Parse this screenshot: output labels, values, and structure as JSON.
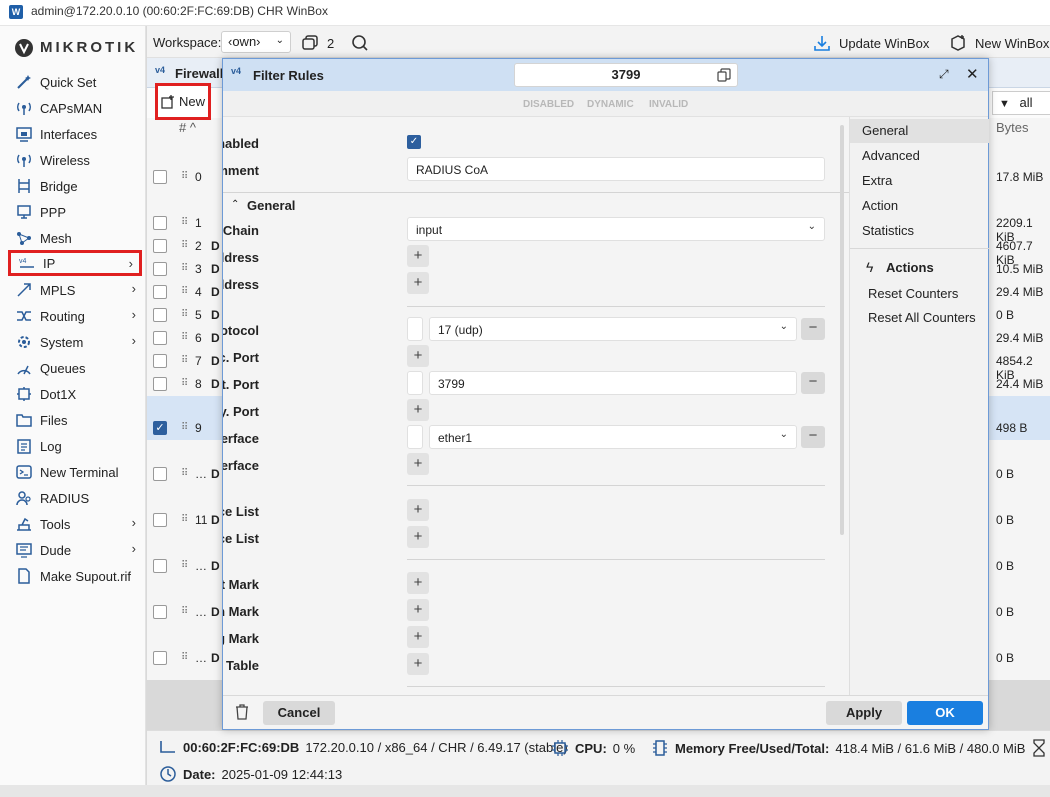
{
  "window": {
    "title": "admin@172.20.0.10 (00:60:2F:FC:69:DB) CHR WinBox"
  },
  "brand": {
    "name": "MIKROTIK"
  },
  "sidebar": {
    "items": [
      {
        "label": "Quick Set"
      },
      {
        "label": "CAPsMAN"
      },
      {
        "label": "Interfaces"
      },
      {
        "label": "Wireless"
      },
      {
        "label": "Bridge"
      },
      {
        "label": "PPP"
      },
      {
        "label": "Mesh"
      },
      {
        "label": "IP"
      },
      {
        "label": "MPLS"
      },
      {
        "label": "Routing"
      },
      {
        "label": "System"
      },
      {
        "label": "Queues"
      },
      {
        "label": "Dot1X"
      },
      {
        "label": "Files"
      },
      {
        "label": "Log"
      },
      {
        "label": "New Terminal"
      },
      {
        "label": "RADIUS"
      },
      {
        "label": "Tools"
      },
      {
        "label": "Dude"
      },
      {
        "label": "Make Supout.rif"
      }
    ]
  },
  "topbar": {
    "workspace_label": "Workspace:",
    "workspace_value": "‹own›",
    "windows_count": "2",
    "update_label": "Update WinBox",
    "new_label": "New WinBox"
  },
  "firewall": {
    "title": "Firewall",
    "new_label": "New",
    "filter_label": "all",
    "col_hash": "#",
    "col_bytes": "Bytes",
    "rows": [
      {
        "num": "0",
        "flag": "",
        "bytes": "17.8 MiB"
      },
      {
        "num": "1",
        "flag": "",
        "bytes": "2209.1 KiB"
      },
      {
        "num": "2",
        "flag": "D",
        "bytes": "4607.7 KiB"
      },
      {
        "num": "3",
        "flag": "D",
        "bytes": "10.5 MiB"
      },
      {
        "num": "4",
        "flag": "D",
        "bytes": "29.4 MiB"
      },
      {
        "num": "5",
        "flag": "D",
        "bytes": "0 B"
      },
      {
        "num": "6",
        "flag": "D",
        "bytes": "29.4 MiB"
      },
      {
        "num": "7",
        "flag": "D",
        "bytes": "4854.2 KiB"
      },
      {
        "num": "8",
        "flag": "D",
        "bytes": "24.4 MiB"
      },
      {
        "num": "9",
        "flag": "",
        "bytes": "498 B"
      },
      {
        "num": "…",
        "flag": "D",
        "bytes": "0 B"
      },
      {
        "num": "11",
        "flag": "D",
        "bytes": "0 B"
      },
      {
        "num": "…",
        "flag": "D",
        "bytes": "0 B"
      },
      {
        "num": "…",
        "flag": "D",
        "bytes": "0 B"
      },
      {
        "num": "…",
        "flag": "D",
        "bytes": "0 B"
      }
    ]
  },
  "dialog": {
    "title": "Filter Rules",
    "id": "3799",
    "flags": [
      "DISABLED",
      "DYNAMIC",
      "INVALID"
    ],
    "enabled_label": "Enabled",
    "comment_label": "Comment",
    "comment_value": "RADIUS CoA",
    "section_general": "General",
    "chain_label": "Chain",
    "chain_value": "input",
    "src_address_label": "Src. Address",
    "dst_address_label": "Dst. Address",
    "protocol_label": "Protocol",
    "protocol_value": "17 (udp)",
    "src_port_label": "Src. Port",
    "dst_port_label": "Dst. Port",
    "dst_port_value": "3799",
    "any_port_label": "Any. Port",
    "in_interface_label": "In. Interface",
    "in_interface_value": "ether1",
    "out_interface_label": "Out. Interface",
    "in_interface_list_label": "In. Interface List",
    "out_interface_list_label": "Out. Interface List",
    "packet_mark_label": "Packet Mark",
    "connection_mark_label": "Connection Mark",
    "routing_mark_label": "Routing Mark",
    "routing_table_label": "Routing Table",
    "nav": [
      "General",
      "Advanced",
      "Extra",
      "Action",
      "Statistics"
    ],
    "actions_title": "Actions",
    "reset_counters": "Reset Counters",
    "reset_all_counters": "Reset All Counters",
    "cancel_label": "Cancel",
    "apply_label": "Apply",
    "ok_label": "OK"
  },
  "status": {
    "mac": "00:60:2F:FC:69:DB",
    "system": "172.20.0.10 / x86_64 / CHR / 6.49.17 (stable)",
    "cpu_label": "CPU:",
    "cpu_value": "0 %",
    "memory_label": "Memory Free/Used/Total:",
    "memory_value": "418.4 MiB / 61.6 MiB / 480.0 MiB",
    "date_label": "Date:",
    "date_value": "2025-01-09 12:44:13"
  },
  "colors": {
    "accent": "#1a7fe0",
    "highlight": "#e02020",
    "header": "#cfe0f3"
  }
}
